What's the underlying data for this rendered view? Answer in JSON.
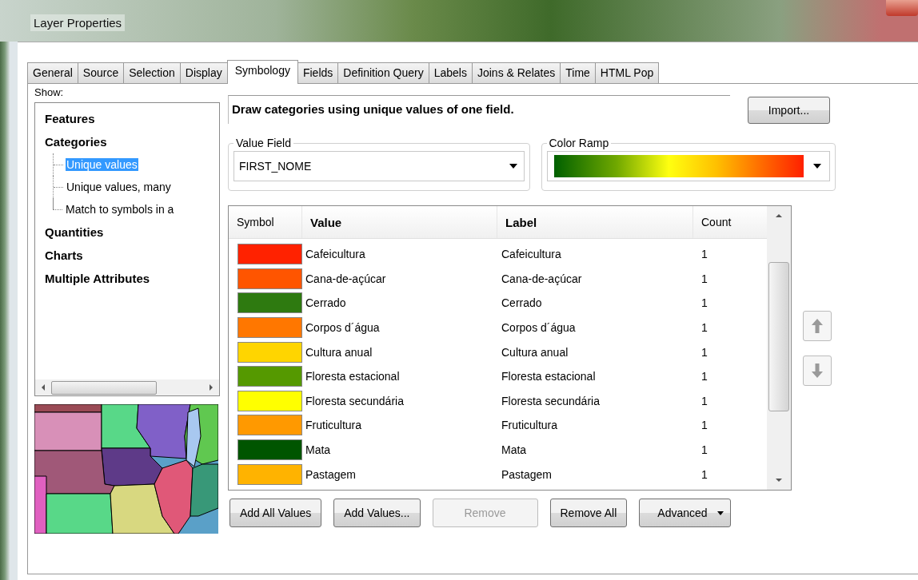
{
  "window": {
    "title": "Layer Properties"
  },
  "tabs": [
    {
      "label": "General",
      "selected": false
    },
    {
      "label": "Source",
      "selected": false
    },
    {
      "label": "Selection",
      "selected": false
    },
    {
      "label": "Display",
      "selected": false
    },
    {
      "label": "Symbology",
      "selected": true
    },
    {
      "label": "Fields",
      "selected": false
    },
    {
      "label": "Definition Query",
      "selected": false
    },
    {
      "label": "Labels",
      "selected": false
    },
    {
      "label": "Joins & Relates",
      "selected": false
    },
    {
      "label": "Time",
      "selected": false
    },
    {
      "label": "HTML Pop",
      "selected": false
    }
  ],
  "show": {
    "label": "Show:",
    "items": [
      {
        "label": "Features",
        "selected": false
      },
      {
        "label": "Categories",
        "selected": false,
        "children": [
          {
            "label": "Unique values",
            "selected": true
          },
          {
            "label": "Unique values, many",
            "selected": false
          },
          {
            "label": "Match to symbols in a",
            "selected": false
          }
        ]
      },
      {
        "label": "Quantities",
        "selected": false
      },
      {
        "label": "Charts",
        "selected": false
      },
      {
        "label": "Multiple Attributes",
        "selected": false
      }
    ]
  },
  "description": "Draw categories using unique values of one field.",
  "import_button": "Import...",
  "value_field": {
    "legend": "Value Field",
    "value": "FIRST_NOME"
  },
  "color_ramp": {
    "legend": "Color Ramp"
  },
  "table": {
    "columns": [
      "Symbol",
      "Value",
      "Label",
      "Count"
    ],
    "rows": [
      {
        "color": "#ff2200",
        "value": "Cafeicultura",
        "label": "Cafeicultura",
        "count": "1"
      },
      {
        "color": "#ff5500",
        "value": "Cana-de-açúcar",
        "label": "Cana-de-açúcar",
        "count": "1"
      },
      {
        "color": "#2e7a10",
        "value": "Cerrado",
        "label": "Cerrado",
        "count": "1"
      },
      {
        "color": "#ff7700",
        "value": "Corpos d´água",
        "label": "Corpos d´água",
        "count": "1"
      },
      {
        "color": "#ffd500",
        "value": "Cultura anual",
        "label": "Cultura anual",
        "count": "1"
      },
      {
        "color": "#559900",
        "value": "Floresta estacional",
        "label": "Floresta estacional",
        "count": "1"
      },
      {
        "color": "#ffff00",
        "value": "Floresta secundária",
        "label": "Floresta secundária",
        "count": "1"
      },
      {
        "color": "#ff9900",
        "value": "Fruticultura",
        "label": "Fruticultura",
        "count": "1"
      },
      {
        "color": "#005500",
        "value": "Mata",
        "label": "Mata",
        "count": "1"
      },
      {
        "color": "#ffb300",
        "value": "Pastagem",
        "label": "Pastagem",
        "count": "1"
      }
    ]
  },
  "buttons": [
    {
      "label": "Add All Values",
      "kind": "plain",
      "disabled": false
    },
    {
      "label": "Add Values...",
      "kind": "plain",
      "disabled": false
    },
    {
      "label": "Remove",
      "kind": "plain",
      "disabled": true
    },
    {
      "label": "Remove All",
      "kind": "plain",
      "disabled": false
    },
    {
      "label": "Advanced",
      "kind": "dropdown",
      "disabled": false
    }
  ]
}
